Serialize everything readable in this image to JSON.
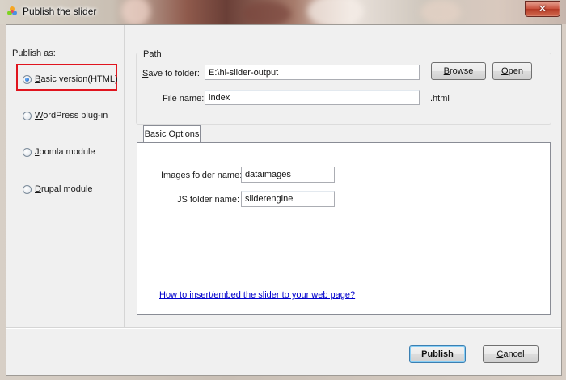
{
  "window": {
    "title": "Publish the slider",
    "close_symbol": "✕"
  },
  "left_panel": {
    "heading": "Publish as:",
    "options": [
      {
        "label_mnemonic": "B",
        "label_rest": "asic version(HTML)",
        "checked": true
      },
      {
        "label_mnemonic": "W",
        "label_rest": "ordPress plug-in",
        "checked": false
      },
      {
        "label_mnemonic": "J",
        "label_rest": "oomla module",
        "checked": false
      },
      {
        "label_mnemonic": "D",
        "label_rest": "rupal module",
        "checked": false
      }
    ]
  },
  "path_group": {
    "legend": "Path",
    "save_label_mnemonic": "S",
    "save_label_rest": "ave to folder:",
    "save_value": "E:\\hi-slider-output",
    "filename_label": "File name:",
    "filename_value": "index",
    "extension": ".html",
    "browse_mnemonic": "B",
    "browse_rest": "rowse",
    "open_mnemonic": "O",
    "open_rest": "pen"
  },
  "tabs": [
    {
      "label": "Basic Options",
      "active": true
    }
  ],
  "basic_options": {
    "images_label": "Images folder name:",
    "images_value": "dataimages",
    "js_label": "JS folder name:",
    "js_value": "sliderengine",
    "help_link": "How to insert/embed the slider to your web page?"
  },
  "footer": {
    "publish_label": "Publish",
    "cancel_mnemonic": "C",
    "cancel_rest": "ancel"
  },
  "colors": {
    "highlight_box": "#e0141e",
    "link": "#0000cc"
  }
}
